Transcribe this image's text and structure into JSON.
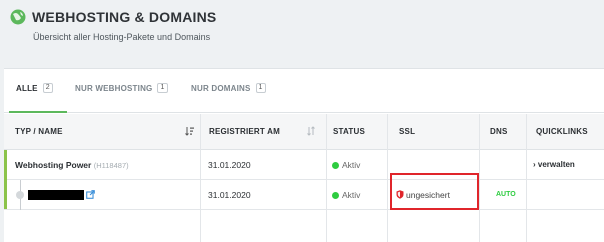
{
  "header": {
    "title": "WEBHOSTING & DOMAINS",
    "subtitle": "Übersicht aller Hosting-Pakete und Domains",
    "icon": "globe-icon"
  },
  "tabs": [
    {
      "label": "ALLE",
      "count": "2",
      "active": true
    },
    {
      "label": "NUR WEBHOSTING",
      "count": "1",
      "active": false
    },
    {
      "label": "NUR DOMAINS",
      "count": "1",
      "active": false
    }
  ],
  "table": {
    "columns": [
      "TYP / NAME",
      "REGISTRIERT AM",
      "STATUS",
      "SSL",
      "DNS",
      "QUICKLINKS"
    ],
    "rows": [
      {
        "name": "Webhosting Power",
        "id": "(H118487)",
        "registered": "31.01.2020",
        "status": "Aktiv",
        "ssl": "",
        "dns": "",
        "quicklink": "verwalten"
      },
      {
        "name": "",
        "registered": "31.01.2020",
        "status": "Aktiv",
        "ssl": "ungesichert",
        "dns": "AUTO",
        "quicklink": ""
      }
    ]
  },
  "colors": {
    "accent_green": "#5cb85c",
    "status_green": "#2ecc40",
    "ssl_red": "#e0252b"
  }
}
